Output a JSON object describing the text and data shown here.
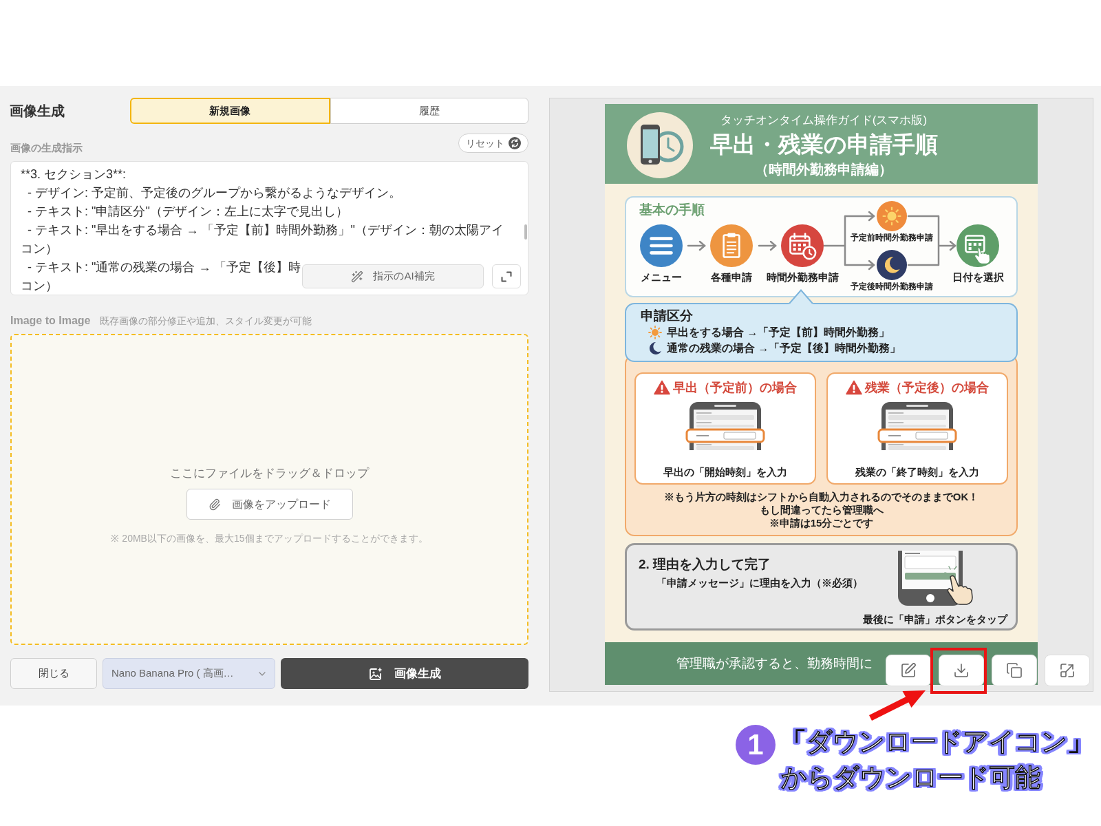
{
  "panel": {
    "title": "画像生成"
  },
  "tabs": [
    {
      "label": "新規画像",
      "selected": true
    },
    {
      "label": "履歴",
      "selected": false
    }
  ],
  "prompt": {
    "label": "画像の生成指示",
    "reset_button": "リセット",
    "lines": [
      "**3. セクション3**:",
      "  - デザイン: 予定前、予定後のグループから繋がるようなデザイン。",
      "  - テキスト: \"申請区分\"（デザイン：左上に太字で見出し）",
      "  - テキスト: \"早出をする場合 → 「予定【前】時間外勤務」\"（デザイン：朝の太陽アイ",
      "コン）",
      "  - テキスト: \"通常の残業の場合 → 「予定【後】時",
      "コン）"
    ],
    "ai_button": "指示のAI補完"
  },
  "image_to_image": {
    "label": "Image to Image",
    "description": "既存画像の部分修正や追加、スタイル変更が可能",
    "drop_hint": "ここにファイルをドラッグ＆ドロップ",
    "upload_button": "画像をアップロード",
    "note": "※ 20MB以下の画像を、最大15個までアップロードすることができます。"
  },
  "actions_bar": {
    "close_button": "閉じる",
    "model_select": "Nano Banana Pro ( 高画…",
    "generate_button": "画像生成"
  },
  "preview": {
    "guide": {
      "subtitle": "タッチオンタイム操作ガイド(スマホ版)",
      "title": "早出・残業の申請手順",
      "edition": "（時間外勤務申請編）",
      "basic": {
        "heading": "基本の手順",
        "steps": [
          {
            "kind": "menu",
            "label": "メニュー"
          },
          {
            "kind": "clipboard",
            "label": "各種申請"
          },
          {
            "kind": "calendar",
            "label": "時間外勤務申請"
          }
        ],
        "branches": [
          {
            "kind": "sun",
            "label": "予定前時間外勤務申請"
          },
          {
            "kind": "moon",
            "label": "予定後時間外勤務申請"
          }
        ],
        "last_step": {
          "kind": "date",
          "label": "日付を選択"
        }
      },
      "category": {
        "heading": "申請区分",
        "items": [
          {
            "kind": "sun",
            "text": "早出をする場合 →「予定【前】時間外勤務」"
          },
          {
            "kind": "moon",
            "text": "通常の残業の場合 →「予定【後】時間外勤務」"
          }
        ]
      },
      "cases": [
        {
          "title": "早出（予定前）の場合",
          "caption": "早出の「開始時刻」を入力"
        },
        {
          "title": "残業（予定後）の場合",
          "caption": "残業の「終了時刻」を入力"
        }
      ],
      "notes": [
        "※もう片方の時刻はシフトから自動入力されるのでそのままでOK！",
        "もし間違ってたら管理職へ",
        "※申請は15分ごとです"
      ],
      "step2": {
        "title": "2. 理由を入力して完了",
        "text": "「申請メッセージ」に理由を入力（※必須）",
        "caption": "最後に「申請」ボタンをタップ"
      },
      "footer": "管理職が承認すると、勤務時間に"
    },
    "actions": [
      {
        "kind": "edit",
        "highlighted": false
      },
      {
        "kind": "download",
        "highlighted": true
      },
      {
        "kind": "copy",
        "highlighted": false
      },
      {
        "kind": "expand",
        "highlighted": false
      }
    ]
  },
  "annotation": {
    "number": "1",
    "lines": [
      "「ダウンロードアイコン」",
      "からダウンロード可能"
    ]
  }
}
